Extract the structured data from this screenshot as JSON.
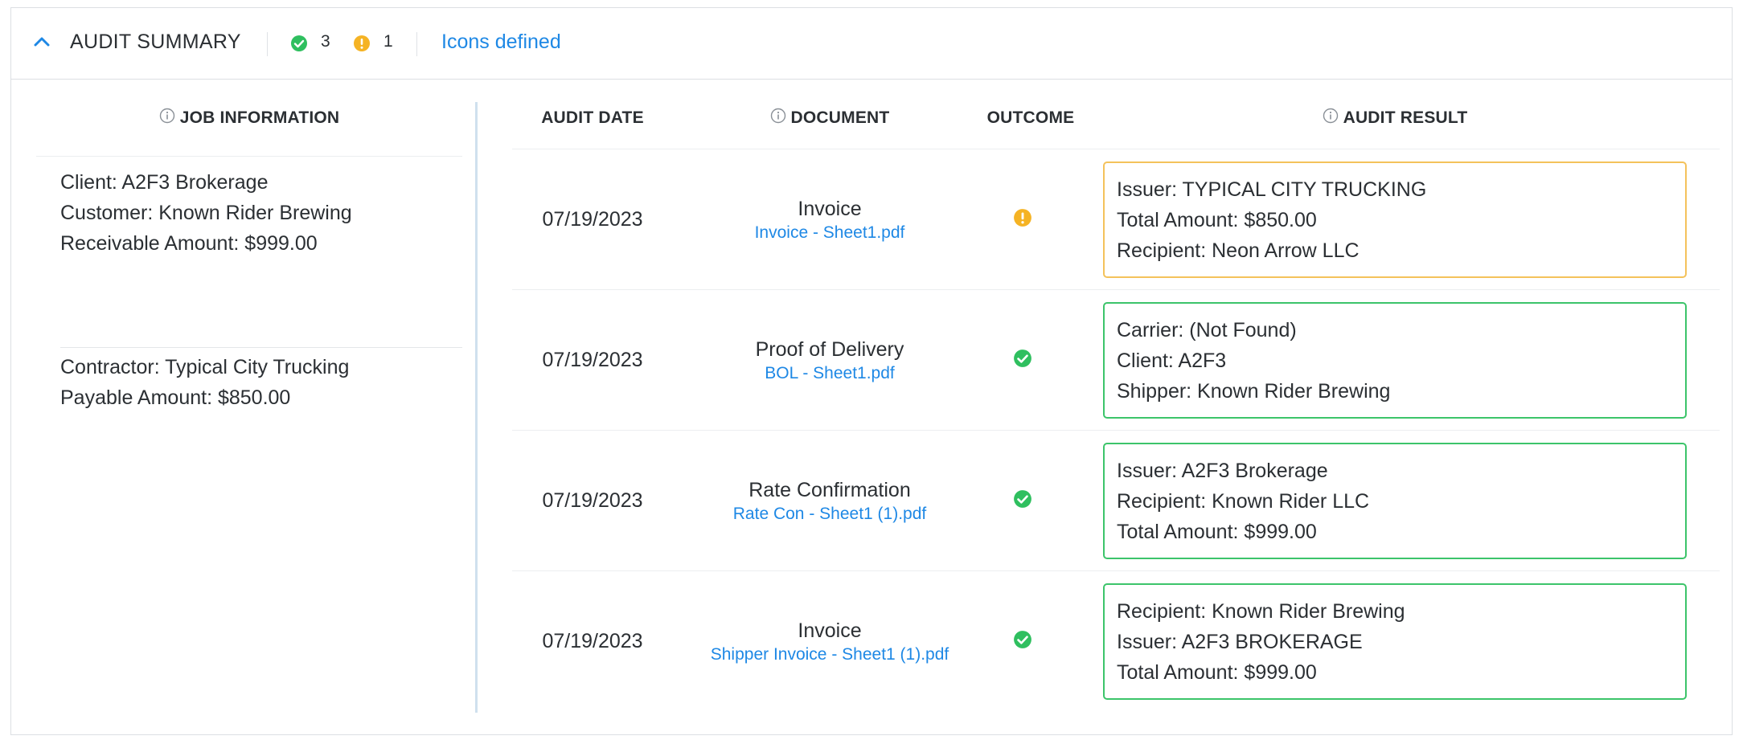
{
  "header": {
    "title": "AUDIT SUMMARY",
    "success_count": "3",
    "warning_count": "1",
    "link_label": "Icons defined"
  },
  "columns": {
    "job_information": "JOB INFORMATION",
    "audit_date": "AUDIT DATE",
    "document": "DOCUMENT",
    "outcome": "OUTCOME",
    "audit_result": "AUDIT RESULT"
  },
  "job": {
    "client": "Client: A2F3 Brokerage",
    "customer": "Customer: Known Rider Brewing",
    "receivable": "Receivable Amount: $999.00",
    "contractor": "Contractor: Typical City Trucking",
    "payable": "Payable Amount: $850.00"
  },
  "audits": [
    {
      "date": "07/19/2023",
      "doc_type": "Invoice",
      "doc_file": "Invoice - Sheet1.pdf",
      "outcome": "warning",
      "results": [
        "Issuer: TYPICAL CITY TRUCKING",
        "Total Amount: $850.00",
        "Recipient: Neon Arrow LLC"
      ]
    },
    {
      "date": "07/19/2023",
      "doc_type": "Proof of Delivery",
      "doc_file": "BOL - Sheet1.pdf",
      "outcome": "success",
      "results": [
        "Carrier: (Not Found)",
        "Client: A2F3",
        "Shipper: Known Rider Brewing"
      ]
    },
    {
      "date": "07/19/2023",
      "doc_type": "Rate Confirmation",
      "doc_file": "Rate Con - Sheet1 (1).pdf",
      "outcome": "success",
      "results": [
        "Issuer: A2F3 Brokerage",
        "Recipient: Known Rider LLC",
        "Total Amount: $999.00"
      ]
    },
    {
      "date": "07/19/2023",
      "doc_type": "Invoice",
      "doc_file": "Shipper Invoice - Sheet1 (1).pdf",
      "outcome": "success",
      "results": [
        "Recipient: Known Rider Brewing",
        "Issuer: A2F3 BROKERAGE",
        "Total Amount: $999.00"
      ]
    }
  ],
  "colors": {
    "success": "#2fbf5f",
    "warning": "#f5b324",
    "link": "#1e88e5",
    "divider": "#cfe0ee"
  },
  "icons": {
    "collapse": "chevron-up-icon",
    "success": "check-circle-icon",
    "warning": "exclamation-circle-icon",
    "info": "info-circle-icon"
  }
}
